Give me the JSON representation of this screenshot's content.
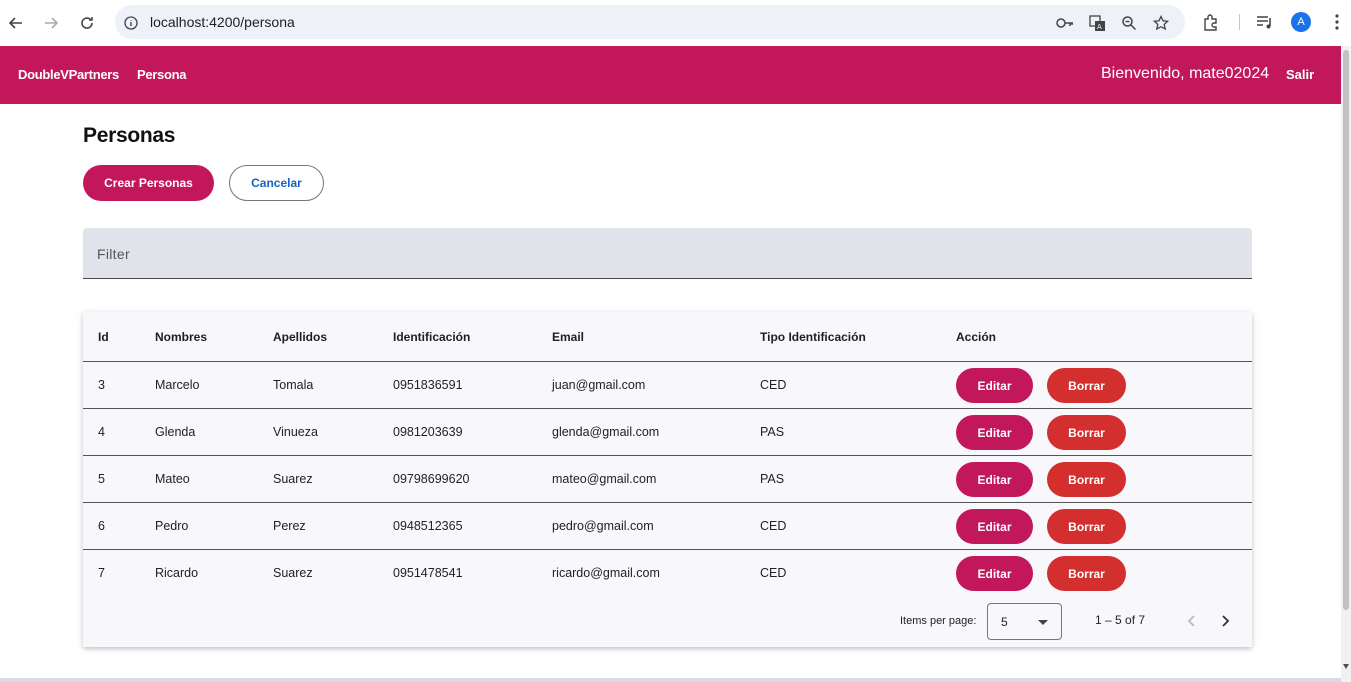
{
  "browser": {
    "url": "localhost:4200/persona",
    "avatar_letter": "A",
    "accent": "#1a73e8"
  },
  "header": {
    "brand": "DoubleVPartners",
    "nav_item": "Persona",
    "welcome": "Bienvenido, mate02024",
    "logout": "Salir",
    "color": "#c2185b"
  },
  "page": {
    "title": "Personas",
    "create_button": "Crear Personas",
    "cancel_button": "Cancelar",
    "filter_label": "Filter"
  },
  "table": {
    "headers": {
      "id": "Id",
      "nombres": "Nombres",
      "apellidos": "Apellidos",
      "identificacion": "Identificación",
      "email": "Email",
      "tipo": "Tipo Identificación",
      "accion": "Acción"
    },
    "edit_label": "Editar",
    "delete_label": "Borrar",
    "edit_color": "#c2185b",
    "delete_color": "#d32f2f",
    "rows": [
      {
        "id": "3",
        "nombres": "Marcelo",
        "apellidos": "Tomala",
        "identificacion": "0951836591",
        "email": "juan@gmail.com",
        "tipo": "CED"
      },
      {
        "id": "4",
        "nombres": "Glenda",
        "apellidos": "Vinueza",
        "identificacion": "0981203639",
        "email": "glenda@gmail.com",
        "tipo": "PAS"
      },
      {
        "id": "5",
        "nombres": "Mateo",
        "apellidos": "Suarez",
        "identificacion": "09798699620",
        "email": "mateo@gmail.com",
        "tipo": "PAS"
      },
      {
        "id": "6",
        "nombres": "Pedro",
        "apellidos": "Perez",
        "identificacion": "0948512365",
        "email": "pedro@gmail.com",
        "tipo": "CED"
      },
      {
        "id": "7",
        "nombres": "Ricardo",
        "apellidos": "Suarez",
        "identificacion": "0951478541",
        "email": "ricardo@gmail.com",
        "tipo": "CED"
      }
    ]
  },
  "paginator": {
    "items_per_page_label": "Items per page:",
    "items_per_page_value": "5",
    "range": "1 – 5 of 7"
  }
}
